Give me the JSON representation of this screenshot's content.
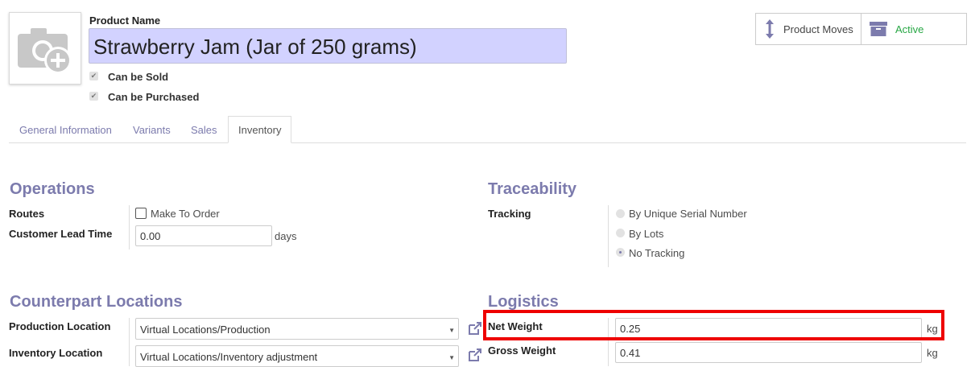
{
  "header": {
    "product_name_label": "Product Name",
    "product_name_value": "Strawberry Jam (Jar of 250 grams)",
    "can_be_sold_label": "Can be Sold",
    "can_be_purchased_label": "Can be Purchased",
    "image_icon": "camera-plus-icon"
  },
  "button_box": {
    "product_moves_label": "Product Moves",
    "product_moves_icon": "up-down-arrow-icon",
    "active_label": "Active",
    "active_icon": "archive-icon",
    "active_color": "#28a745"
  },
  "tabs": [
    {
      "label": "General Information"
    },
    {
      "label": "Variants"
    },
    {
      "label": "Sales"
    },
    {
      "label": "Inventory"
    }
  ],
  "active_tab": "Inventory",
  "operations": {
    "title": "Operations",
    "routes_label": "Routes",
    "make_to_order_label": "Make To Order",
    "lead_time_label": "Customer Lead Time",
    "lead_time_value": "0.00",
    "lead_time_unit": "days"
  },
  "traceability": {
    "title": "Traceability",
    "tracking_label": "Tracking",
    "options": [
      "By Unique Serial Number",
      "By Lots",
      "No Tracking"
    ],
    "selected": "No Tracking"
  },
  "counterpart": {
    "title": "Counterpart Locations",
    "production_label": "Production Location",
    "production_value": "Virtual Locations/Production",
    "inventory_label": "Inventory Location",
    "inventory_value": "Virtual Locations/Inventory adjustment"
  },
  "logistics": {
    "title": "Logistics",
    "net_weight_label": "Net Weight",
    "net_weight_value": "0.25",
    "net_weight_unit": "kg",
    "gross_weight_label": "Gross Weight",
    "gross_weight_value": "0.41",
    "gross_weight_unit": "kg"
  },
  "colors": {
    "accent": "#7c7bad",
    "name_input_bg": "#d2d2ff",
    "highlight": "#ee0000"
  }
}
